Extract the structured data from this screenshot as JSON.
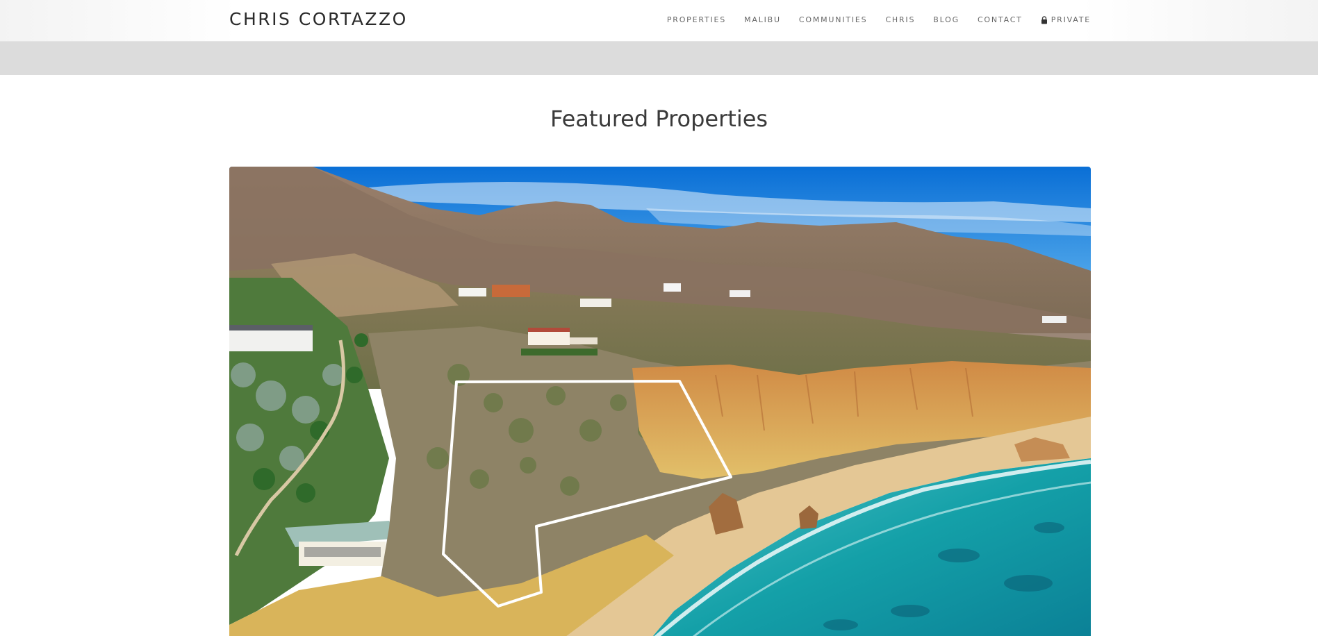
{
  "header": {
    "logo": "CHRIS CORTAZZO",
    "nav": [
      {
        "label": "PROPERTIES"
      },
      {
        "label": "MALIBU"
      },
      {
        "label": "COMMUNITIES"
      },
      {
        "label": "CHRIS"
      },
      {
        "label": "BLOG"
      },
      {
        "label": "CONTACT"
      },
      {
        "label": "PRIVATE",
        "icon": "lock-icon"
      }
    ]
  },
  "main": {
    "section_title": "Featured Properties",
    "featured_image": {
      "subject": "aerial-coastline-photo",
      "overlay": "property-boundary-outline"
    }
  },
  "colors": {
    "nav_text": "#666666",
    "logo_text": "#2a2a2a",
    "band": "#dcdcdc",
    "sky": "#1e88e5",
    "ocean": "#1aa3a3"
  }
}
